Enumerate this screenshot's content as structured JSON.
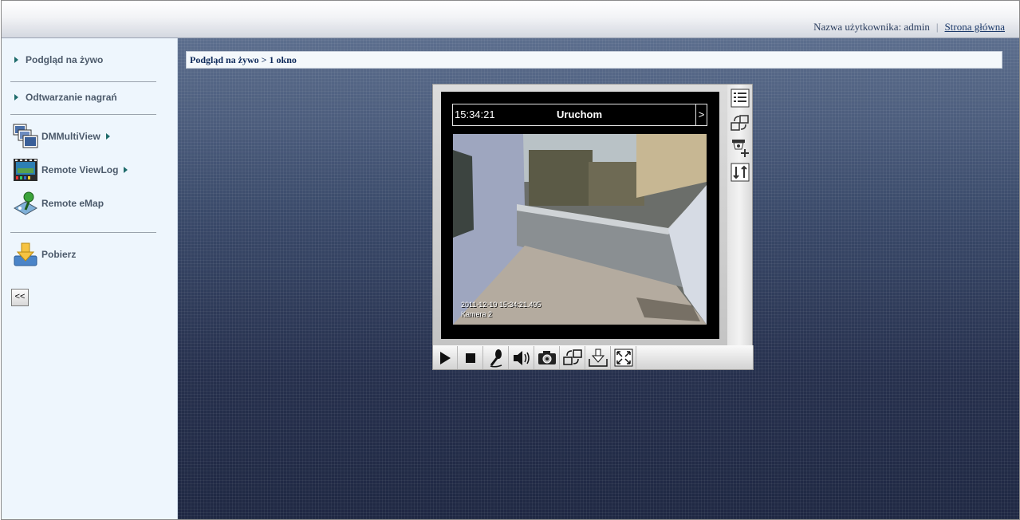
{
  "header": {
    "user_label": "Nazwa użytkownika: admin",
    "separator": "|",
    "home_link": "Strona główna"
  },
  "sidebar": {
    "items": [
      {
        "label": "Podgląd na żywo"
      },
      {
        "label": "Odtwarzanie nagrań"
      }
    ],
    "tools": [
      {
        "label": "DMMultiView",
        "icon": "multiview-icon"
      },
      {
        "label": "Remote ViewLog",
        "icon": "viewlog-film-icon"
      },
      {
        "label": "Remote eMap",
        "icon": "emap-icon"
      }
    ],
    "download": {
      "label": "Pobierz",
      "icon": "download-icon"
    },
    "collapse_label": "<<"
  },
  "main": {
    "breadcrumb": "Podgląd na żywo > 1 okno"
  },
  "viewer": {
    "time": "15:34:21",
    "status": "Uruchom",
    "arrow": ">",
    "osd_timestamp": "2011-12-19 15:34:21.495",
    "osd_camera": "Kamera 2",
    "side_buttons": [
      "list-menu-icon",
      "swap-window-icon",
      "ptz-camera-icon",
      "channel-switch-icon"
    ],
    "controls": [
      "play-icon",
      "stop-icon",
      "microphone-icon",
      "speaker-icon",
      "snapshot-camera-icon",
      "swap-window-icon",
      "download-icon",
      "fullscreen-icon"
    ]
  },
  "colors": {
    "accent_triangle": "#1e6b6b",
    "sidebar_bg": "#eef6fd",
    "main_bg": "#2a3553",
    "breadcrumb_text": "#0e2a5a"
  }
}
